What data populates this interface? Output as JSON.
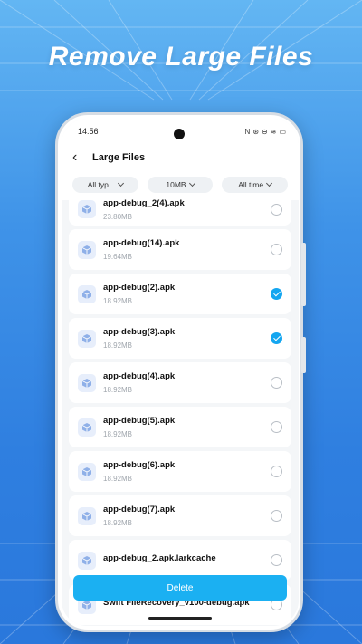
{
  "promo": {
    "title": "Remove Large Files"
  },
  "status_bar": {
    "time": "14:56",
    "icons": [
      "nfc-icon",
      "wifi-calling-icon",
      "dnd-icon",
      "wifi-icon",
      "battery-icon"
    ]
  },
  "header": {
    "back_icon": "back-arrow-icon",
    "title": "Large Files"
  },
  "filters": [
    {
      "label": "All typ..."
    },
    {
      "label": "10MB"
    },
    {
      "label": "All time"
    }
  ],
  "files": [
    {
      "name": "app-debug_2(4).apk",
      "size": "23.80MB",
      "checked": false
    },
    {
      "name": "app-debug(14).apk",
      "size": "19.64MB",
      "checked": false
    },
    {
      "name": "app-debug(2).apk",
      "size": "18.92MB",
      "checked": true
    },
    {
      "name": "app-debug(3).apk",
      "size": "18.92MB",
      "checked": true
    },
    {
      "name": "app-debug(4).apk",
      "size": "18.92MB",
      "checked": false
    },
    {
      "name": "app-debug(5).apk",
      "size": "18.92MB",
      "checked": false
    },
    {
      "name": "app-debug(6).apk",
      "size": "18.92MB",
      "checked": false
    },
    {
      "name": "app-debug(7).apk",
      "size": "18.92MB",
      "checked": false
    },
    {
      "name": "app-debug_2.apk.larkcache",
      "size": "",
      "checked": false
    },
    {
      "name": "Swift FileRecovery_v100-debug.apk",
      "size": "",
      "checked": false
    }
  ],
  "actions": {
    "delete_label": "Delete"
  },
  "colors": {
    "accent": "#1bb0f2",
    "background": "#3f93e8"
  }
}
